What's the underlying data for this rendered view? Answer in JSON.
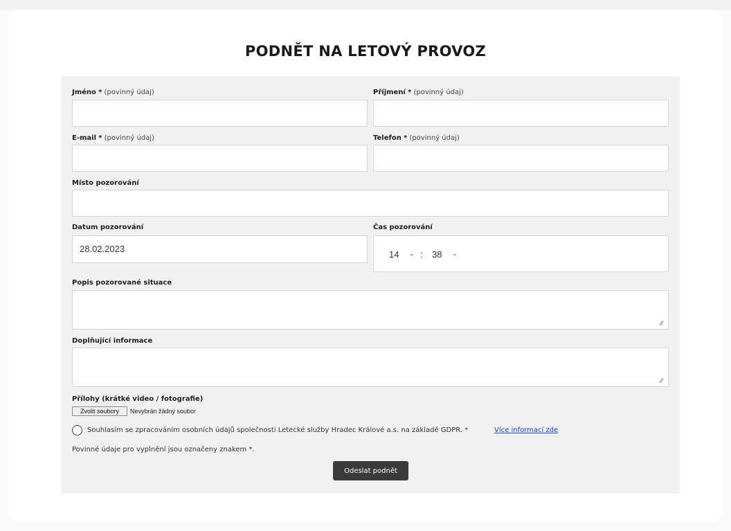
{
  "page": {
    "title": "PODNĚT NA LETOVÝ PROVOZ"
  },
  "form": {
    "first_name": {
      "label": "Jméno",
      "required_mark": "*",
      "hint": "(povinný údaj)",
      "value": ""
    },
    "last_name": {
      "label": "Příjmení",
      "required_mark": "*",
      "hint": "(povinný údaj)",
      "value": ""
    },
    "email": {
      "label": "E-mail",
      "required_mark": "*",
      "hint": "(povinný údaj)",
      "value": ""
    },
    "phone": {
      "label": "Telefon",
      "required_mark": "*",
      "hint": "(povinný údaj)",
      "value": ""
    },
    "place": {
      "label": "Místo pozorování",
      "value": ""
    },
    "date": {
      "label": "Datum pozorování",
      "value": "28.02.2023"
    },
    "time": {
      "label": "Čas pozorování",
      "hour": "14",
      "separator": ":",
      "minute": "38"
    },
    "description": {
      "label": "Popis pozorované situace",
      "value": ""
    },
    "additional": {
      "label": "Doplňující informace",
      "value": ""
    },
    "attachments": {
      "label": "Přílohy (krátké video / fotografie)",
      "button_label": "Zvolit soubory",
      "status": "Nevybrán žádný soubor"
    },
    "consent": {
      "text": "Souhlasím se zpracováním osobních údajů společnosti Letecké služby Hradec Králové a.s. na základě GDPR. *",
      "link_label": "Více informací zde",
      "checked": false
    },
    "required_note": "Povinné údaje pro vyplnění jsou označeny znakem *.",
    "submit_label": "Odeslat podnět"
  }
}
